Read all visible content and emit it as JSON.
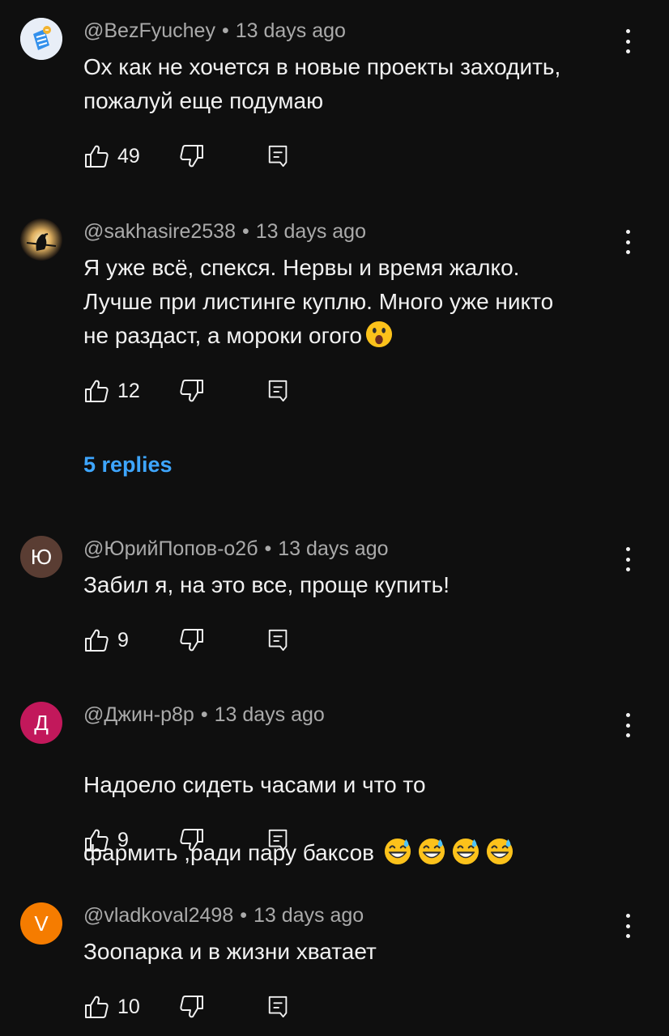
{
  "colors": {
    "background": "#0f0f0f",
    "text": "#f1f1f1",
    "meta_text": "#aaaaaa",
    "link": "#3ea6ff",
    "avatar_yuri": "#5a3d33",
    "avatar_dzhin": "#c2185b",
    "avatar_vlad": "#f57c00"
  },
  "comments": [
    {
      "author": "@BezFyuchey",
      "sep": "•",
      "time": "13 days ago",
      "text": "Ох как не хочется в новые проекты заходить,\nпожалуй еще подумаю",
      "likes": "49",
      "avatar_icon": "telegram-sticker-icon"
    },
    {
      "author": "@sakhasire2538",
      "sep": "•",
      "time": "13 days ago",
      "text": "Я уже всё, спекся. Нервы и время жалко.\nЛучше при листинге куплю. Много уже никто\nне раздаст, а мороки огого",
      "emoji": "astonished-face-emoji",
      "likes": "12",
      "avatar_icon": "bird-moon-icon",
      "replies_label": "5 replies"
    },
    {
      "author": "@ЮрийПопов-о2б",
      "sep": "•",
      "time": "13 days ago",
      "text": "Забил я, на это все, проще купить!",
      "likes": "9",
      "avatar_letter": "Ю"
    },
    {
      "author": "@Джин-р8р",
      "sep": "•",
      "time": "13 days ago",
      "text_line1": "Надоело сидеть часами и что то",
      "text_line2": "фармить ,ради пару баксов",
      "emoji": "grinning-sweat-face-emoji",
      "emoji_count": 4,
      "likes": "9",
      "avatar_letter": "Д"
    },
    {
      "author": "@vladkoval2498",
      "sep": "•",
      "time": "13 days ago",
      "text": "Зоопарка и в жизни хватает",
      "likes": "10",
      "avatar_letter": "V"
    }
  ]
}
